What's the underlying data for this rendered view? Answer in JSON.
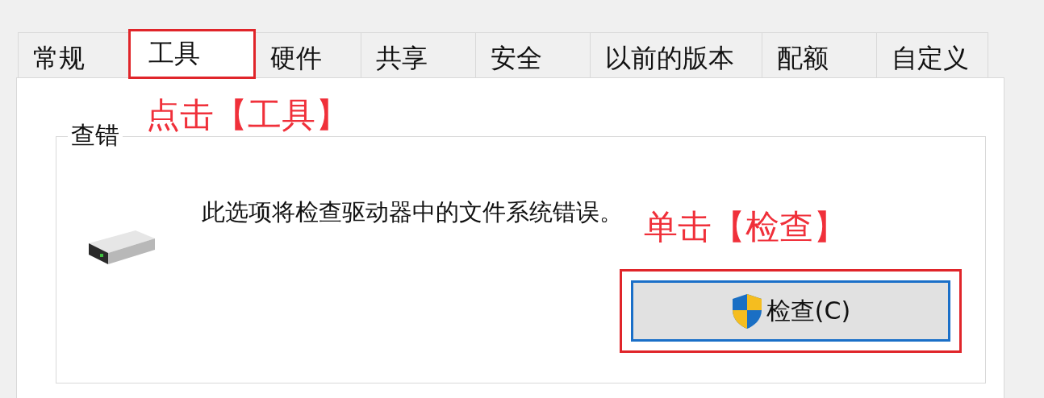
{
  "tabs": [
    {
      "label": "常规",
      "selected": false,
      "highlighted": false
    },
    {
      "label": "工具",
      "selected": true,
      "highlighted": true
    },
    {
      "label": "硬件",
      "selected": false,
      "highlighted": false
    },
    {
      "label": "共享",
      "selected": false,
      "highlighted": false
    },
    {
      "label": "安全",
      "selected": false,
      "highlighted": false
    },
    {
      "label": "以前的版本",
      "selected": false,
      "highlighted": false
    },
    {
      "label": "配额",
      "selected": false,
      "highlighted": false
    },
    {
      "label": "自定义",
      "selected": false,
      "highlighted": false
    }
  ],
  "group": {
    "title": "查错",
    "description": "此选项将检查驱动器中的文件系统错误。",
    "button": {
      "label": "检查(C)",
      "highlighted": true
    }
  },
  "annotations": [
    "点击【工具】",
    "单击【检查】"
  ]
}
